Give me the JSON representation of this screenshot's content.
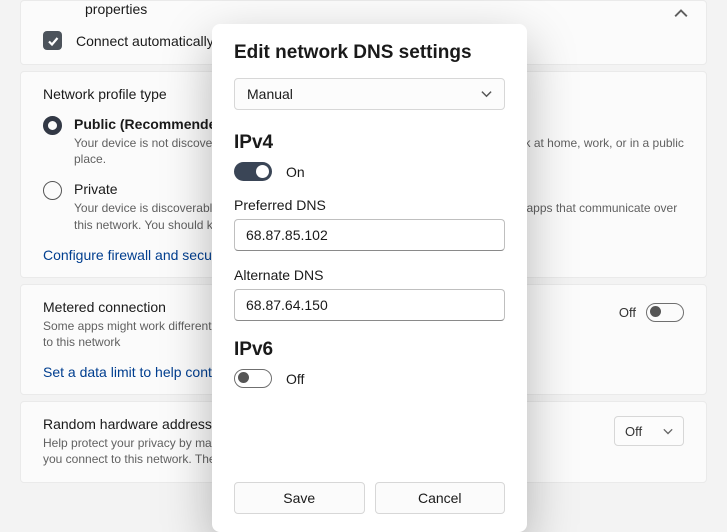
{
  "bg": {
    "properties_tail": "properties",
    "connect_auto": "Connect automatically",
    "profile_type": "Network profile type",
    "public_title": "Public (Recommended)",
    "public_desc": "Your device is not discoverable on the network. Use this when connected to a network at home, work, or in a public place.",
    "private_title": "Private",
    "private_desc": "Your device is discoverable on the network. Select this if you need file sharing or use apps that communicate over this network. You should know and trust the people and devices on the network.",
    "firewall_link": "Configure firewall and security settings",
    "metered_title": "Metered connection",
    "metered_desc": "Some apps might work differently to reduce data usage when you're connected to this network",
    "metered_off": "Off",
    "data_limit_link": "Set a data limit to help control data usage on this network",
    "random_title": "Random hardware addresses",
    "random_desc": "Help protect your privacy by making it harder for people to track your device location when you connect to this network. The setting applies only to this network.",
    "random_off": "Off"
  },
  "modal": {
    "title": "Edit network DNS settings",
    "mode": "Manual",
    "ipv4_heading": "IPv4",
    "ipv4_on": "On",
    "preferred_label": "Preferred DNS",
    "preferred_value": "68.87.85.102",
    "alternate_label": "Alternate DNS",
    "alternate_value": "68.87.64.150",
    "ipv6_heading": "IPv6",
    "ipv6_off": "Off",
    "save": "Save",
    "cancel": "Cancel"
  }
}
